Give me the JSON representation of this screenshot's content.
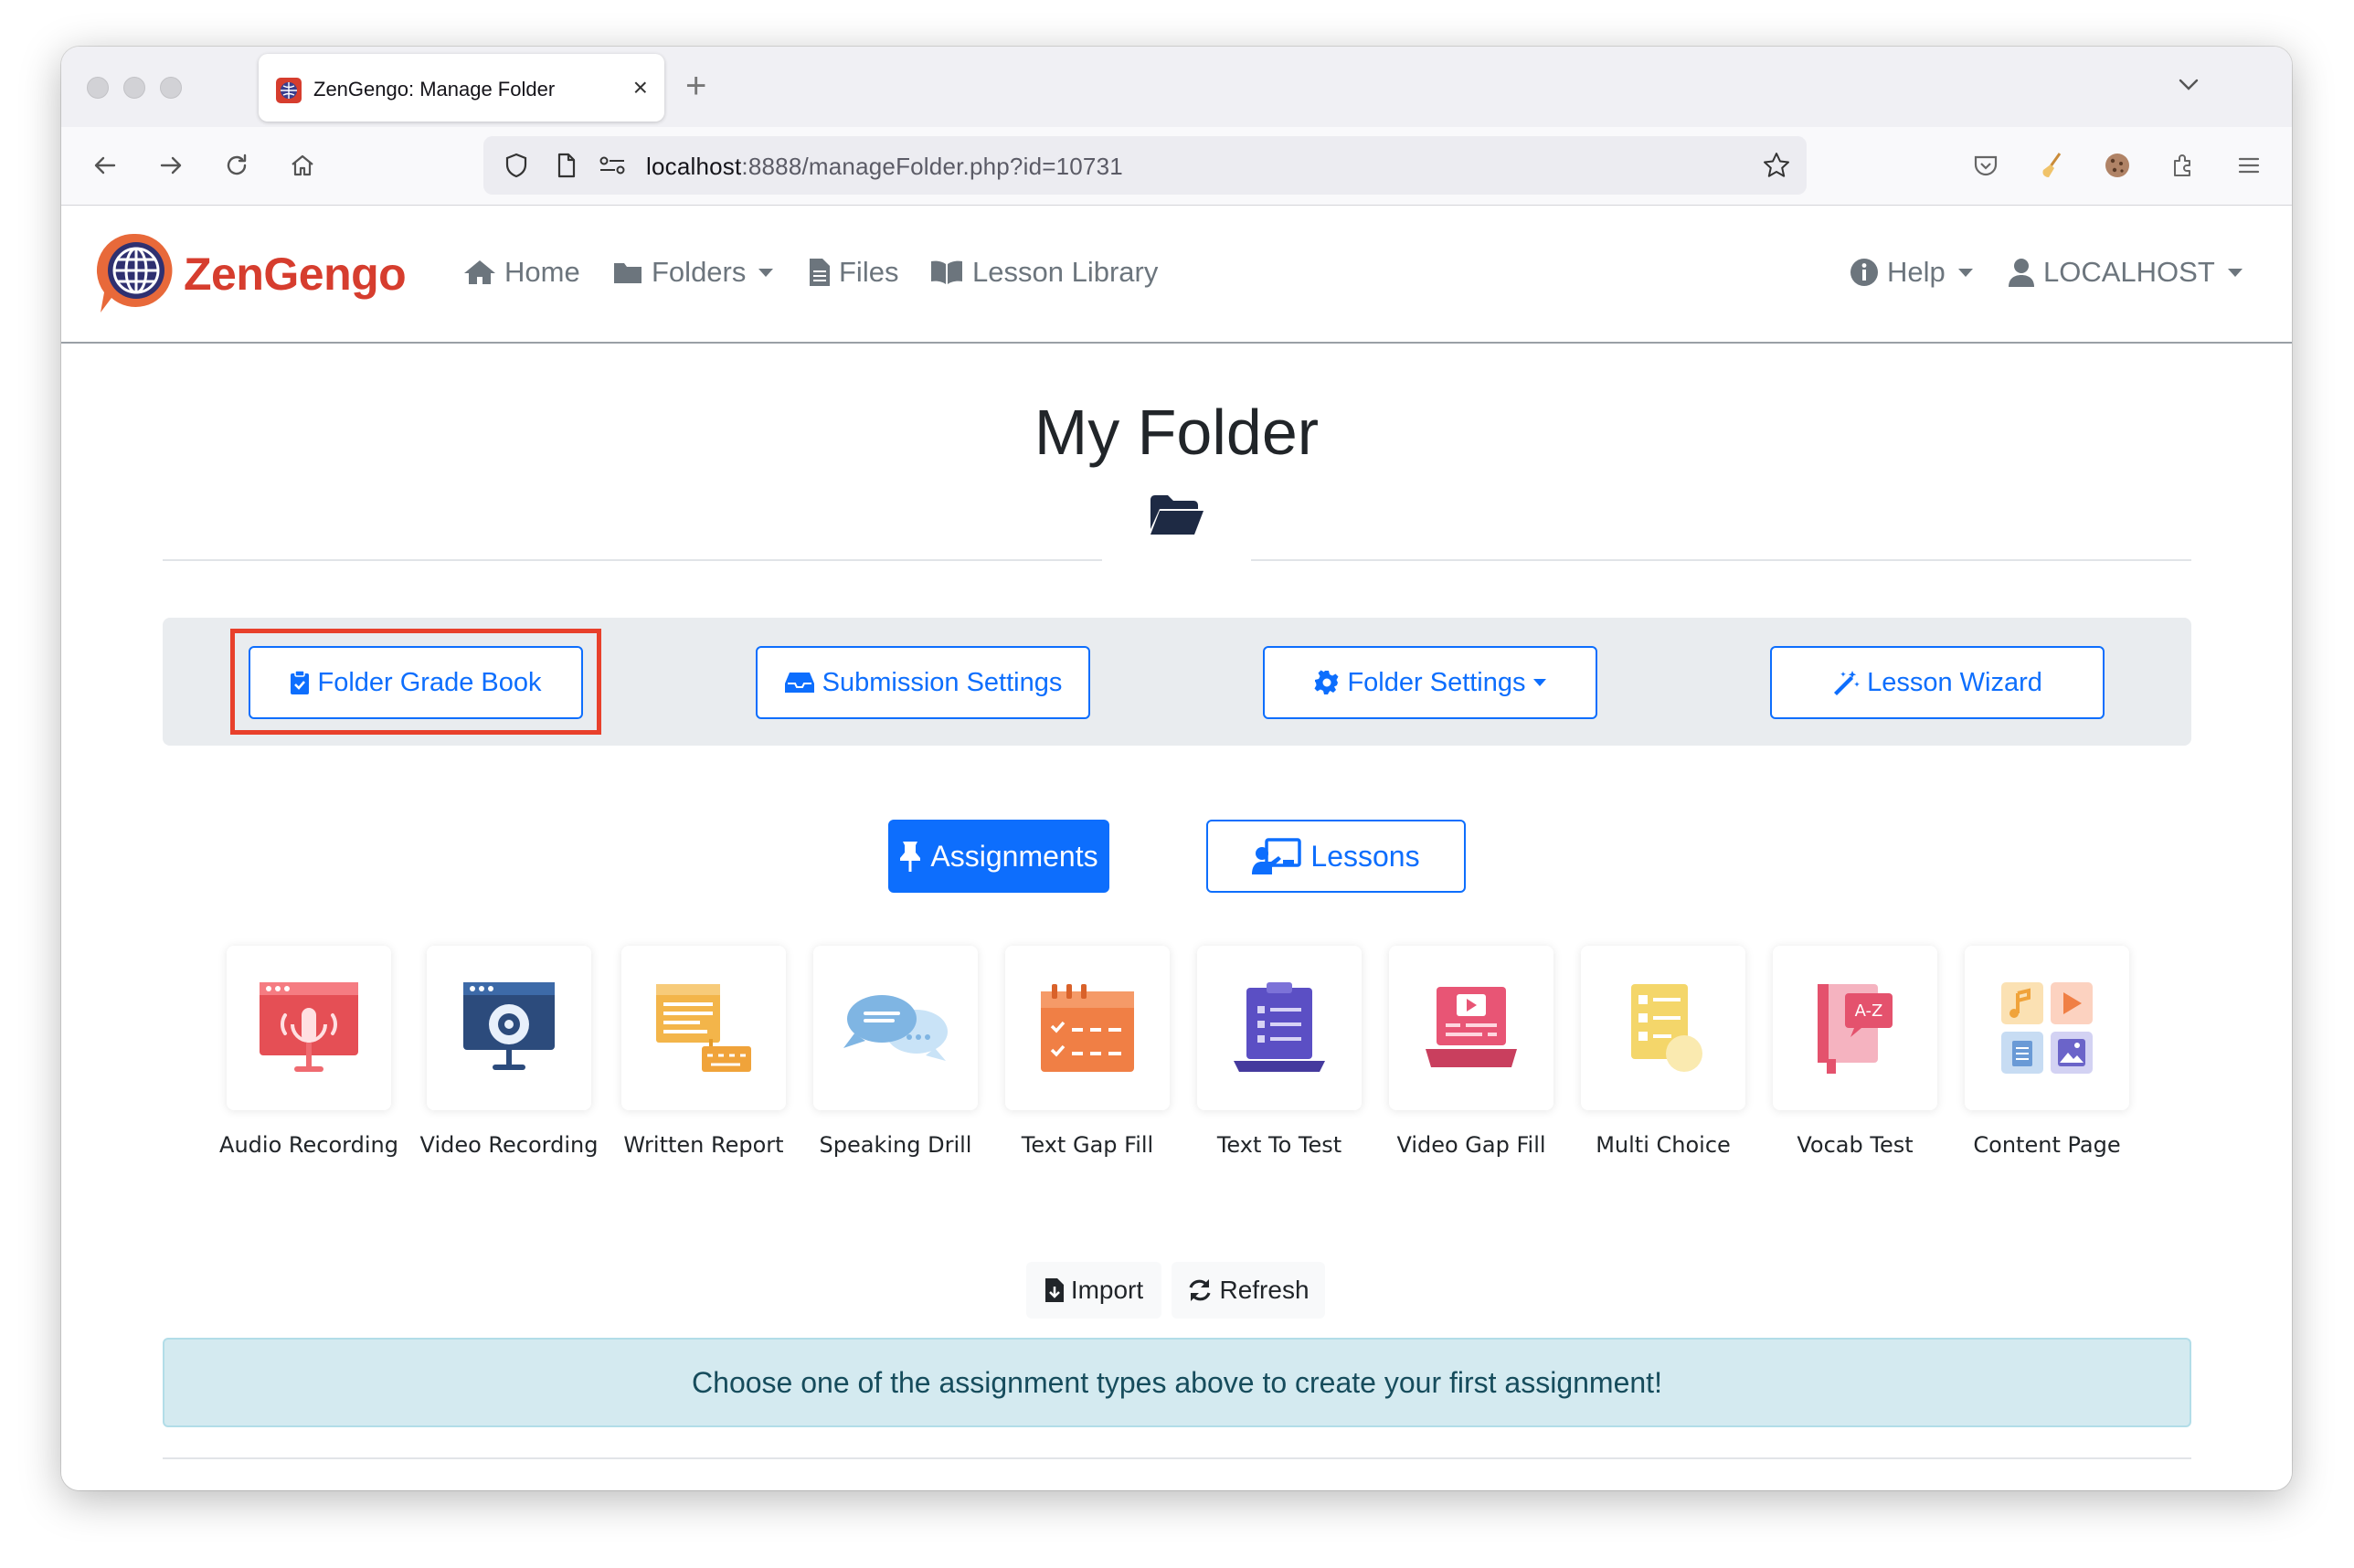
{
  "browser": {
    "tab_title": "ZenGengo: Manage Folder",
    "tab_close": "×",
    "new_tab": "+",
    "url_host": "localhost",
    "url_rest": ":8888/manageFolder.php?id=10731"
  },
  "site": {
    "brand": "ZenGengo",
    "nav": {
      "home": "Home",
      "folders": "Folders",
      "files": "Files",
      "lesson_library": "Lesson Library",
      "help": "Help",
      "user": "LOCALHOST"
    }
  },
  "page": {
    "title": "My Folder",
    "toolbar": {
      "grade_book": "Folder Grade Book",
      "submission_settings": "Submission Settings",
      "folder_settings": "Folder Settings",
      "lesson_wizard": "Lesson Wizard"
    },
    "tabs": {
      "assignments": "Assignments",
      "lessons": "Lessons"
    },
    "assignment_types": [
      {
        "label": "Audio Recording",
        "icon": "audio-recording-icon"
      },
      {
        "label": "Video Recording",
        "icon": "video-recording-icon"
      },
      {
        "label": "Written Report",
        "icon": "written-report-icon"
      },
      {
        "label": "Speaking Drill",
        "icon": "speaking-drill-icon"
      },
      {
        "label": "Text Gap Fill",
        "icon": "text-gap-fill-icon"
      },
      {
        "label": "Text To Test",
        "icon": "text-to-test-icon"
      },
      {
        "label": "Video Gap Fill",
        "icon": "video-gap-fill-icon"
      },
      {
        "label": "Multi Choice",
        "icon": "multi-choice-icon"
      },
      {
        "label": "Vocab Test",
        "icon": "vocab-test-icon"
      },
      {
        "label": "Content Page",
        "icon": "content-page-icon"
      }
    ],
    "actions": {
      "import": "Import",
      "refresh": "Refresh"
    },
    "alert": "Choose one of the assignment types above to create your first assignment!"
  },
  "colors": {
    "primary": "#0d6efd",
    "brand": "#d63d2e",
    "highlight": "#e8402b",
    "alert_bg": "#d4eaf0"
  }
}
